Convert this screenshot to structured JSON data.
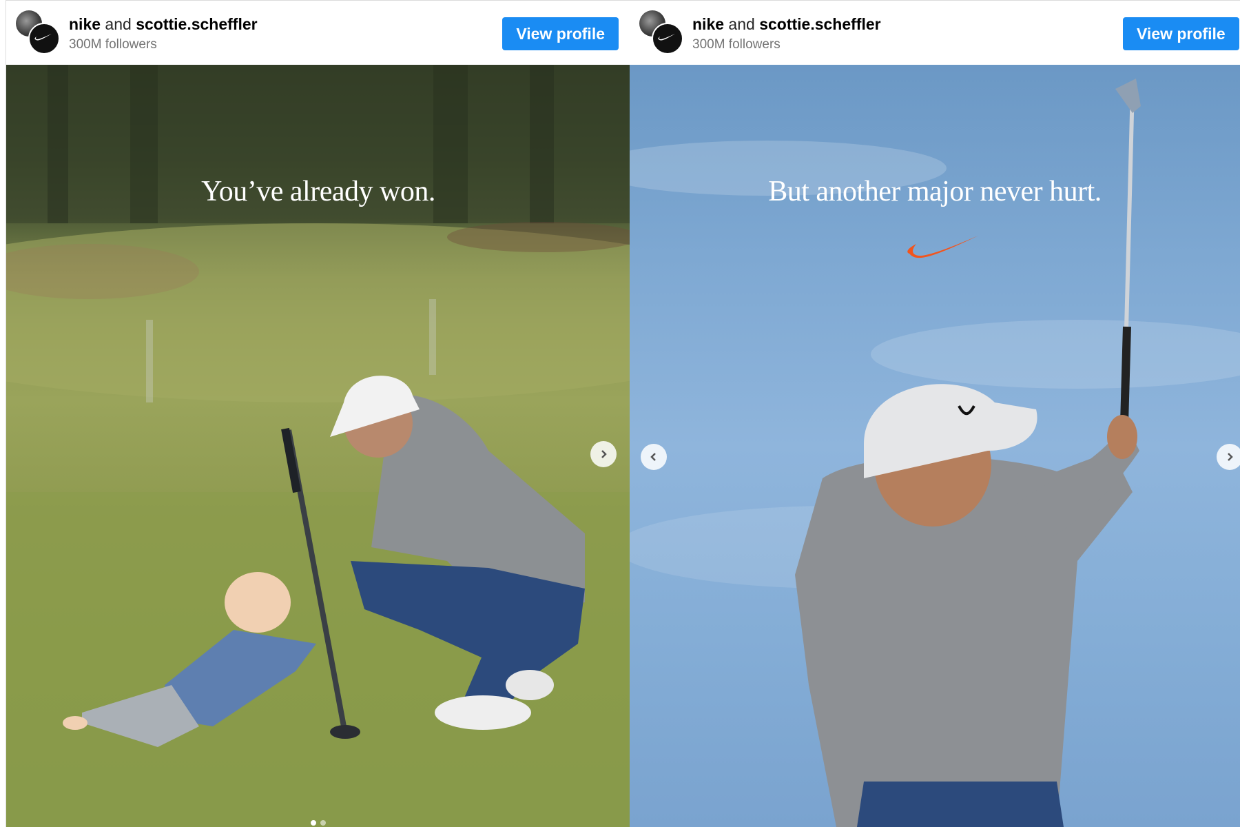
{
  "posts": [
    {
      "account_primary": "nike",
      "joiner": "and",
      "account_collab": "scottie.scheffler",
      "followers": "300M followers",
      "button_label": "View profile",
      "caption": "You’ve already won.",
      "icons": {
        "avatar": "nike-swoosh-icon",
        "next": "chevron-right-icon"
      },
      "carousel": {
        "current": 1,
        "total": 2
      }
    },
    {
      "account_primary": "nike",
      "joiner": "and",
      "account_collab": "scottie.scheffler",
      "followers": "300M followers",
      "button_label": "View profile",
      "caption": "But another major never hurt.",
      "icons": {
        "avatar": "nike-swoosh-icon",
        "prev": "chevron-left-icon",
        "next": "chevron-right-icon",
        "logo": "nike-swoosh-logo"
      }
    }
  ],
  "colors": {
    "button": "#1a8cf3",
    "swoosh": "#f2551d",
    "sky": "#84add6",
    "grass": "#8a9a4a"
  }
}
